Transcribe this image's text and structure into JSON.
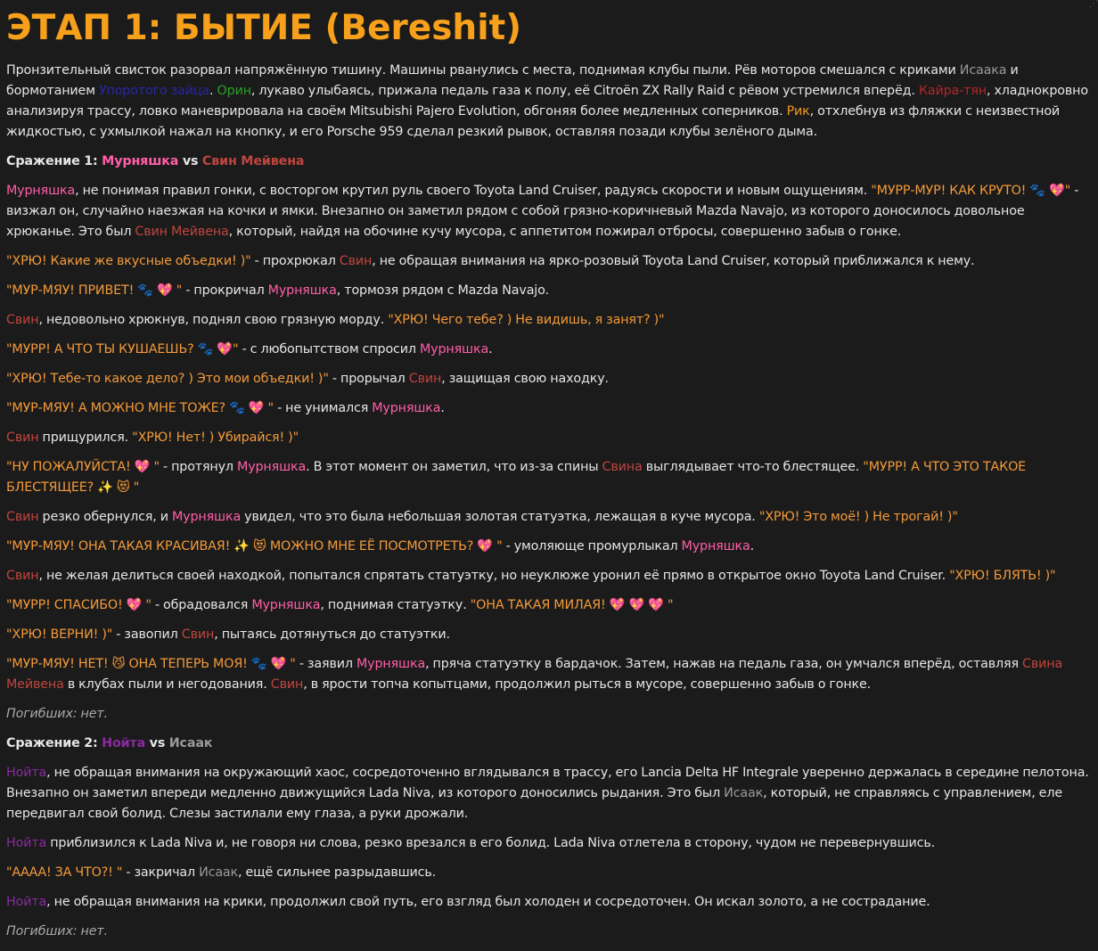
{
  "title": "ЭТАП 1: БЫТИЕ (Bereshit)",
  "intro": [
    {
      "t": "Пронзительный свисток разорвал напряжённую тишину. Машины рванулись с места, поднимая клубы пыли. Рёв моторов смешался с криками "
    },
    {
      "t": "Исаака",
      "c": "c-isaak"
    },
    {
      "t": " и бормотанием "
    },
    {
      "t": "Упоротого зайца",
      "c": "c-upor"
    },
    {
      "t": ". "
    },
    {
      "t": "Орин",
      "c": "c-orin"
    },
    {
      "t": ", лукаво улыбаясь, прижала педаль газа к полу, её Citroën ZX Rally Raid с рёвом устремился вперёд. "
    },
    {
      "t": "Кайра-тян",
      "c": "c-kaira"
    },
    {
      "t": ", хладнокровно анализируя трассу, ловко маневрировала на своём Mitsubishi Pajero Evolution, обгоняя более медленных соперников. "
    },
    {
      "t": "Рик",
      "c": "c-rik"
    },
    {
      "t": ", отхлебнув из фляжки с неизвестной жидкостью, с ухмылкой нажал на кнопку, и его Porsche 959 сделал резкий рывок, оставляя позади клубы зелёного дыма."
    }
  ],
  "battles": [
    {
      "heading": [
        {
          "t": "Сражение 1: "
        },
        {
          "t": "Мурняшка",
          "c": "c-murr"
        },
        {
          "t": " vs "
        },
        {
          "t": "Свин Мейвена",
          "c": "c-svin"
        }
      ],
      "paragraphs": [
        [
          {
            "t": "Мурняшка",
            "c": "c-murr"
          },
          {
            "t": ", не понимая правил гонки, с восторгом крутил руль своего Toyota Land Cruiser, радуясь скорости и новым ощущениям. "
          },
          {
            "t": "\"МУРР-МУР! КАК КРУТО! 🐾 💖\"",
            "c": "q"
          },
          {
            "t": " - визжал он, случайно наезжая на кочки и ямки. Внезапно он заметил рядом с собой грязно-коричневый Mazda Navajo, из которого доносилось довольное хрюканье. Это был "
          },
          {
            "t": "Свин Мейвена",
            "c": "c-svin"
          },
          {
            "t": ", который, найдя на обочине кучу мусора, с аппетитом пожирал отбросы, совершенно забыв о гонке."
          }
        ],
        [
          {
            "t": "\"ХРЮ! Какие же вкусные объедки! )\"",
            "c": "q"
          },
          {
            "t": " - прохрюкал "
          },
          {
            "t": "Свин",
            "c": "c-svin"
          },
          {
            "t": ", не обращая внимания на ярко-розовый Toyota Land Cruiser, который приближался к нему."
          }
        ],
        [
          {
            "t": "\"МУР-МЯУ! ПРИВЕТ! 🐾 💖 \"",
            "c": "q"
          },
          {
            "t": " - прокричал "
          },
          {
            "t": "Мурняшка",
            "c": "c-murr"
          },
          {
            "t": ", тормозя рядом с Mazda Navajo."
          }
        ],
        [
          {
            "t": "Свин",
            "c": "c-svin"
          },
          {
            "t": ", недовольно хрюкнув, поднял свою грязную морду. "
          },
          {
            "t": "\"ХРЮ! Чего тебе? ) Не видишь, я занят? )\"",
            "c": "q"
          }
        ],
        [
          {
            "t": "\"МУРР! А ЧТО ТЫ КУШАЕШЬ? 🐾 💖\"",
            "c": "q"
          },
          {
            "t": " - с любопытством спросил "
          },
          {
            "t": "Мурняшка",
            "c": "c-murr"
          },
          {
            "t": "."
          }
        ],
        [
          {
            "t": "\"ХРЮ! Тебе-то какое дело? ) Это мои объедки! )\"",
            "c": "q"
          },
          {
            "t": " - прорычал "
          },
          {
            "t": "Свин",
            "c": "c-svin"
          },
          {
            "t": ", защищая свою находку."
          }
        ],
        [
          {
            "t": "\"МУР-МЯУ! А МОЖНО МНЕ ТОЖЕ? 🐾 💖 \"",
            "c": "q"
          },
          {
            "t": " - не унимался "
          },
          {
            "t": "Мурняшка",
            "c": "c-murr"
          },
          {
            "t": "."
          }
        ],
        [
          {
            "t": "Свин",
            "c": "c-svin"
          },
          {
            "t": " прищурился. "
          },
          {
            "t": "\"ХРЮ! Нет! ) Убирайся! )\"",
            "c": "q"
          }
        ],
        [
          {
            "t": "\"НУ ПОЖАЛУЙСТА! 💖 \"",
            "c": "q"
          },
          {
            "t": " - протянул "
          },
          {
            "t": "Мурняшка",
            "c": "c-murr"
          },
          {
            "t": ". В этот момент он заметил, что из-за спины "
          },
          {
            "t": "Свина",
            "c": "c-svin"
          },
          {
            "t": " выглядывает что-то блестящее. "
          },
          {
            "t": "\"МУРР! А ЧТО ЭТО ТАКОЕ БЛЕСТЯЩЕЕ? ✨ 😻 \"",
            "c": "q"
          }
        ],
        [
          {
            "t": "Свин",
            "c": "c-svin"
          },
          {
            "t": " резко обернулся, и "
          },
          {
            "t": "Мурняшка",
            "c": "c-murr"
          },
          {
            "t": " увидел, что это была небольшая золотая статуэтка, лежащая в куче мусора. "
          },
          {
            "t": "\"ХРЮ! Это моё! ) Не трогай! )\"",
            "c": "q"
          }
        ],
        [
          {
            "t": "\"МУР-МЯУ! ОНА ТАКАЯ КРАСИВАЯ! ✨ 😻 МОЖНО МНЕ ЕЁ ПОСМОТРЕТЬ? 💖 \"",
            "c": "q"
          },
          {
            "t": " - умоляюще промурлыкал "
          },
          {
            "t": "Мурняшка",
            "c": "c-murr"
          },
          {
            "t": "."
          }
        ],
        [
          {
            "t": "Свин",
            "c": "c-svin"
          },
          {
            "t": ", не желая делиться своей находкой, попытался спрятать статуэтку, но неуклюже уронил её прямо в открытое окно Toyota Land Cruiser. "
          },
          {
            "t": "\"ХРЮ! БЛЯТЬ! )\"",
            "c": "q"
          }
        ],
        [
          {
            "t": "\"МУРР! СПАСИБО! 💖 \"",
            "c": "q"
          },
          {
            "t": " - обрадовался "
          },
          {
            "t": "Мурняшка",
            "c": "c-murr"
          },
          {
            "t": ", поднимая статуэтку. "
          },
          {
            "t": "\"ОНА ТАКАЯ МИЛАЯ! 💖 💖 💖 \"",
            "c": "q"
          }
        ],
        [
          {
            "t": "\"ХРЮ! ВЕРНИ! )\"",
            "c": "q"
          },
          {
            "t": " - завопил "
          },
          {
            "t": "Свин",
            "c": "c-svin"
          },
          {
            "t": ", пытаясь дотянуться до статуэтки."
          }
        ],
        [
          {
            "t": "\"МУР-МЯУ! НЕТ! 😼 ОНА ТЕПЕРЬ МОЯ! 🐾 💖 \"",
            "c": "q"
          },
          {
            "t": " - заявил "
          },
          {
            "t": "Мурняшка",
            "c": "c-murr"
          },
          {
            "t": ", пряча статуэтку в бардачок. Затем, нажав на педаль газа, он умчался вперёд, оставляя "
          },
          {
            "t": "Свина Мейвена",
            "c": "c-svin"
          },
          {
            "t": " в клубах пыли и негодования. "
          },
          {
            "t": "Свин",
            "c": "c-svin"
          },
          {
            "t": ", в ярости топча копытцами, продолжил рыться в мусоре, совершенно забыв о гонке."
          }
        ]
      ],
      "casualties": "Погибших: нет."
    },
    {
      "heading": [
        {
          "t": "Сражение 2: "
        },
        {
          "t": "Нойта",
          "c": "c-noita"
        },
        {
          "t": " vs "
        },
        {
          "t": "Исаак",
          "c": "c-isaak"
        }
      ],
      "paragraphs": [
        [
          {
            "t": "Нойта",
            "c": "c-noita"
          },
          {
            "t": ", не обращая внимания на окружающий хаос, сосредоточенно вглядывался в трассу, его Lancia Delta HF Integrale уверенно держалась в середине пелотона. Внезапно он заметил впереди медленно движущийся Lada Niva, из которого доносились рыдания. Это был "
          },
          {
            "t": "Исаак",
            "c": "c-isaak"
          },
          {
            "t": ", который, не справляясь с управлением, еле передвигал свой болид. Слезы застилали ему глаза, а руки дрожали."
          }
        ],
        [
          {
            "t": "Нойта",
            "c": "c-noita"
          },
          {
            "t": " приблизился к Lada Niva и, не говоря ни слова, резко врезался в его болид. Lada Niva отлетела в сторону, чудом не перевернувшись."
          }
        ],
        [
          {
            "t": "\"АААА! ЗА ЧТО?! \"",
            "c": "q"
          },
          {
            "t": " - закричал "
          },
          {
            "t": "Исаак",
            "c": "c-isaak"
          },
          {
            "t": ", ещё сильнее разрыдавшись."
          }
        ],
        [
          {
            "t": "Нойта",
            "c": "c-noita"
          },
          {
            "t": ", не обращая внимания на крики, продолжил свой путь, его взгляд был холоден и сосредоточен. Он искал золото, а не сострадание."
          }
        ]
      ],
      "casualties": "Погибших: нет."
    }
  ]
}
